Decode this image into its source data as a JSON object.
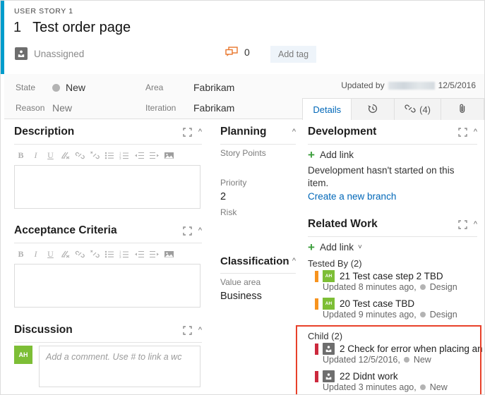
{
  "accent_color": "#009ccc",
  "header": {
    "work_item_type": "USER STORY 1",
    "id": "1",
    "title": "Test order page",
    "assigned_to": "Unassigned",
    "assigned_icon": "person-icon",
    "comment_icon": "comment-icon",
    "comment_count": "0",
    "add_tag_label": "Add tag"
  },
  "fields": {
    "state_label": "State",
    "state_value": "New",
    "state_dot_color": "#b3b3b3",
    "reason_label": "Reason",
    "reason_value": "New",
    "area_label": "Area",
    "area_value": "Fabrikam",
    "iteration_label": "Iteration",
    "iteration_value": "Fabrikam",
    "updated_by_label": "Updated by",
    "updated_by_name": "",
    "updated_date": "12/5/2016"
  },
  "tabs": [
    {
      "label": "Details",
      "icon": "",
      "count": "",
      "active": true
    },
    {
      "label": "",
      "icon": "history-icon",
      "count": "",
      "active": false
    },
    {
      "label": "",
      "icon": "link-icon",
      "count": "(4)",
      "active": false
    },
    {
      "label": "",
      "icon": "attachment-icon",
      "count": "",
      "active": false
    }
  ],
  "description": {
    "title": "Description",
    "expand_icon": "expand-icon",
    "collapse_icon": "chevron-up-icon",
    "content": "",
    "toolbar": [
      "B",
      "I",
      "U",
      "clear-format-icon",
      "link-icon",
      "unlink-icon",
      "bullet-list-icon",
      "numbered-list-icon",
      "outdent-icon",
      "indent-icon",
      "image-icon"
    ]
  },
  "acceptance_criteria": {
    "title": "Acceptance Criteria",
    "expand_icon": "expand-icon",
    "collapse_icon": "chevron-up-icon",
    "content": ""
  },
  "discussion": {
    "title": "Discussion",
    "expand_icon": "expand-icon",
    "collapse_icon": "chevron-up-icon",
    "avatar_initials": "AH",
    "avatar_color": "#7dbe36",
    "placeholder": "Add a comment. Use # to link a wc"
  },
  "planning": {
    "title": "Planning",
    "collapse_icon": "chevron-up-icon",
    "story_points_label": "Story Points",
    "story_points_value": "",
    "priority_label": "Priority",
    "priority_value": "2",
    "risk_label": "Risk",
    "risk_value": ""
  },
  "classification": {
    "title": "Classification",
    "collapse_icon": "chevron-up-icon",
    "value_area_label": "Value area",
    "value_area_value": "Business"
  },
  "development": {
    "title": "Development",
    "expand_icon": "expand-icon",
    "collapse_icon": "chevron-up-icon",
    "add_link_label": "Add link",
    "empty_text": "Development hasn't started on this item.",
    "create_branch_label": "Create a new branch"
  },
  "related_work": {
    "title": "Related Work",
    "expand_icon": "expand-icon",
    "collapse_icon": "chevron-up-icon",
    "add_link_label": "Add link",
    "groups": [
      {
        "label": "Tested By (2)",
        "type_color": "#f7931e",
        "items": [
          {
            "id": "21",
            "title": "Test case step 2 TBD",
            "avatar_initials": "AH",
            "avatar_type": "initials",
            "updated": "Updated 8 minutes ago,",
            "state": "Design"
          },
          {
            "id": "20",
            "title": "Test case TBD",
            "avatar_initials": "AH",
            "avatar_type": "initials",
            "updated": "Updated 9 minutes ago,",
            "state": "Design"
          }
        ]
      },
      {
        "label": "Child (2)",
        "type_color": "#cc293d",
        "highlighted": true,
        "highlight_color": "#e8412a",
        "items": [
          {
            "id": "2",
            "title": "Check for error when placing an order",
            "avatar_initials": "",
            "avatar_type": "unassigned",
            "updated": "Updated 12/5/2016,",
            "state": "New"
          },
          {
            "id": "22",
            "title": "Didnt work",
            "avatar_initials": "",
            "avatar_type": "unassigned",
            "updated": "Updated 3 minutes ago,",
            "state": "New"
          }
        ]
      }
    ]
  }
}
